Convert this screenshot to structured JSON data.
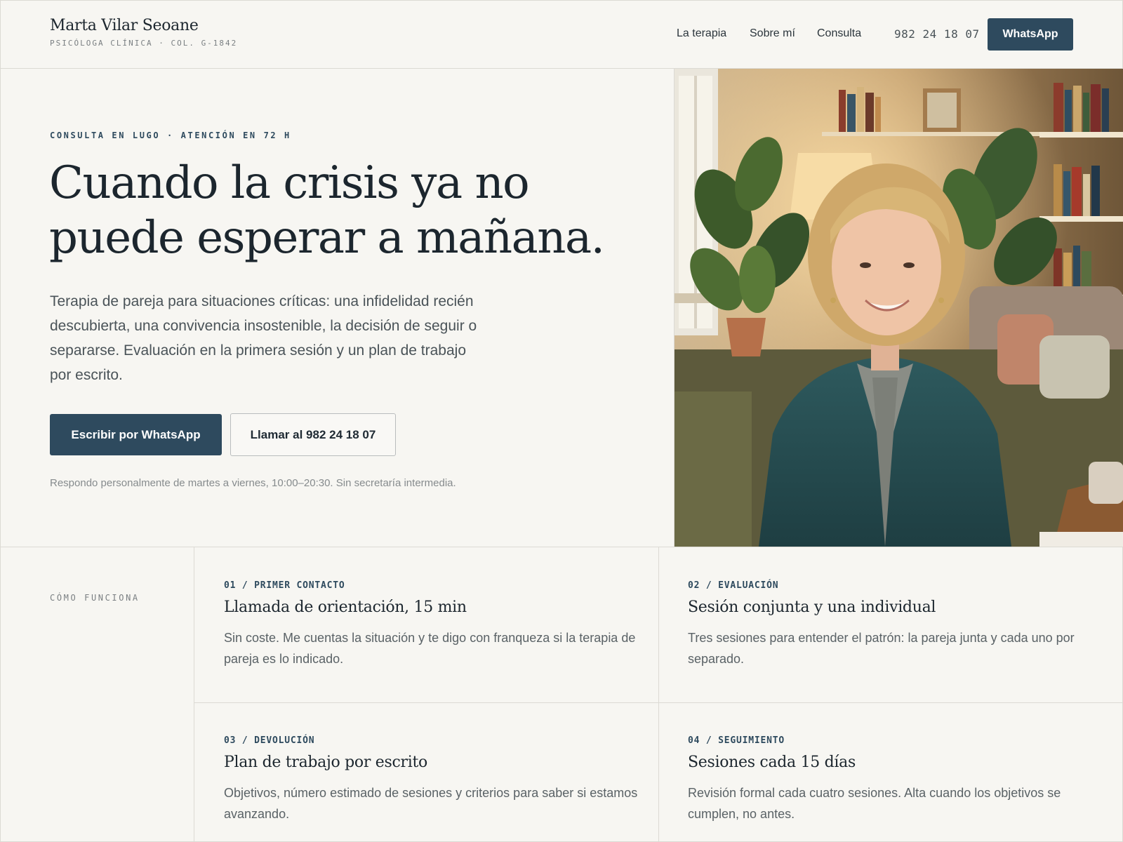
{
  "header": {
    "brand_name": "Marta Vilar Seoane",
    "brand_sub": "PSICÓLOGA CLÍNICA · COL. G-1842",
    "nav": [
      "La terapia",
      "Sobre mí",
      "Consulta"
    ],
    "phone": "982 24 18 07",
    "whatsapp_label": "WhatsApp"
  },
  "hero": {
    "kicker": "CONSULTA EN LUGO · ATENCIÓN EN 72 H",
    "headline": "Cuando la crisis ya no puede esperar a mañana.",
    "lead": "Terapia de pareja para situaciones críticas: una infidelidad recién descubierta, una convivencia insostenible, la decisión de seguir o separarse. Evaluación en la primera sesión y un plan de trabajo por escrito.",
    "primary_cta": "Escribir por WhatsApp",
    "secondary_cta": "Llamar al 982 24 18 07",
    "note": "Respondo personalmente de martes a viernes, 10:00–20:30. Sin secretaría intermedia."
  },
  "steps": {
    "label": "CÓMO FUNCIONA",
    "items": [
      {
        "num": "01 / PRIMER CONTACTO",
        "title": "Llamada de orientación, 15 min",
        "text": "Sin coste. Me cuentas la situación y te digo con franqueza si la terapia de pareja es lo indicado."
      },
      {
        "num": "02 / EVALUACIÓN",
        "title": "Sesión conjunta y una individual",
        "text": "Tres sesiones para entender el patrón: la pareja junta y cada uno por separado."
      },
      {
        "num": "03 / DEVOLUCIÓN",
        "title": "Plan de trabajo por escrito",
        "text": "Objetivos, número estimado de sesiones y criterios para saber si estamos avanzando."
      },
      {
        "num": "04 / SEGUIMIENTO",
        "title": "Sesiones cada 15 días",
        "text": "Revisión formal cada cuatro sesiones. Alta cuando los objetivos se cumplen, no antes."
      }
    ]
  },
  "colors": {
    "accent": "#2e4a5e",
    "background": "#f7f6f2",
    "text": "#1c262e"
  }
}
